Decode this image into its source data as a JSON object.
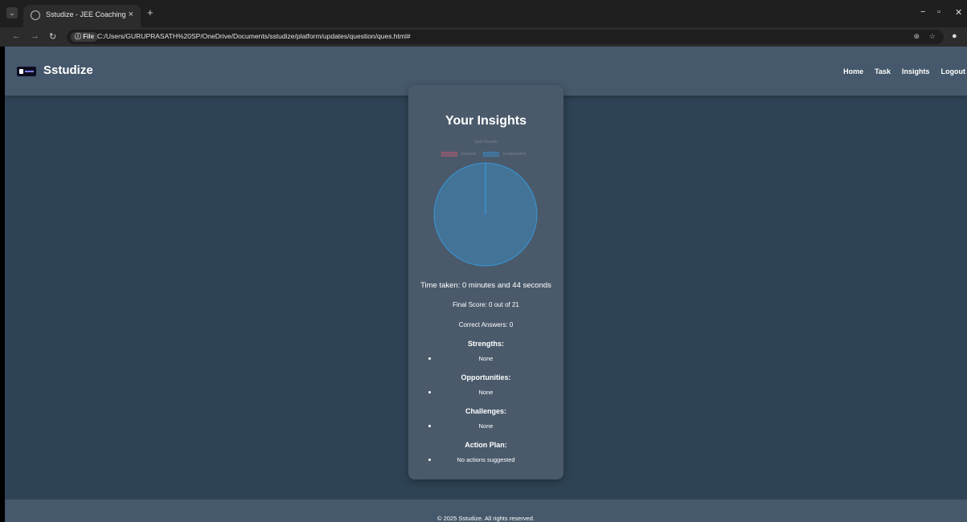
{
  "browser": {
    "tab_title": "Sstudize - JEE Coaching",
    "tab_close": "×",
    "new_tab": "+",
    "file_label": "File",
    "url": "C:/Users/GURUPRASATH%20SP/OneDrive/Documents/sstudize/platform/updates/question/ques.html#"
  },
  "site": {
    "brand": "Sstudize",
    "nav": [
      "Home",
      "Task",
      "Insights",
      "Logout"
    ],
    "footer": "© 2025 Sstudize. All rights reserved."
  },
  "insights": {
    "title": "Your Insights",
    "time_taken": "Time taken: 0 minutes and 44 seconds",
    "final_score": "Final Score: 0 out of 21",
    "correct_answers": "Correct Answers: 0",
    "sections": [
      {
        "heading": "Strengths:",
        "items": [
          "None"
        ]
      },
      {
        "heading": "Opportunities:",
        "items": [
          "None"
        ]
      },
      {
        "heading": "Challenges:",
        "items": [
          "None"
        ]
      },
      {
        "heading": "Action Plan:",
        "items": [
          "No actions suggested"
        ]
      }
    ]
  },
  "chart_data": {
    "type": "pie",
    "title": "Quiz Results",
    "categories": [
      "Incorrect",
      "Unattempted"
    ],
    "values": [
      0,
      100
    ],
    "colors": [
      "#ff6384",
      "#36a2eb"
    ]
  }
}
